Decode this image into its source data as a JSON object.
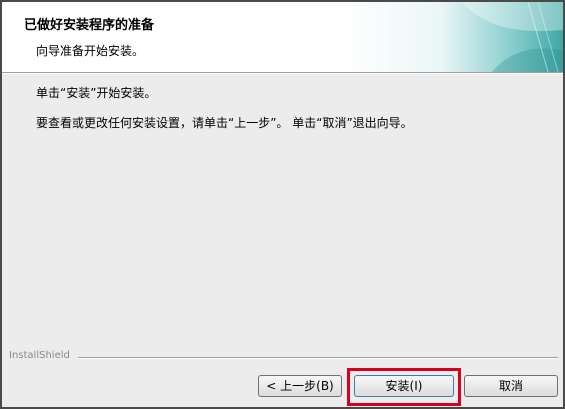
{
  "header": {
    "title": "已做好安装程序的准备",
    "subtitle": "向导准备开始安装。"
  },
  "body": {
    "line1": "单击“安装”开始安装。",
    "line2": "要查看或更改任何安装设置，请单击“上一步”。 单击“取消”退出向导。"
  },
  "footer": {
    "brand": "InstallShield",
    "back_label": "< 上一步(B)",
    "install_label": "安装(I)",
    "cancel_label": "取消"
  },
  "colors": {
    "highlight": "#d9001b",
    "banner_teal": "#3fa7a7"
  }
}
